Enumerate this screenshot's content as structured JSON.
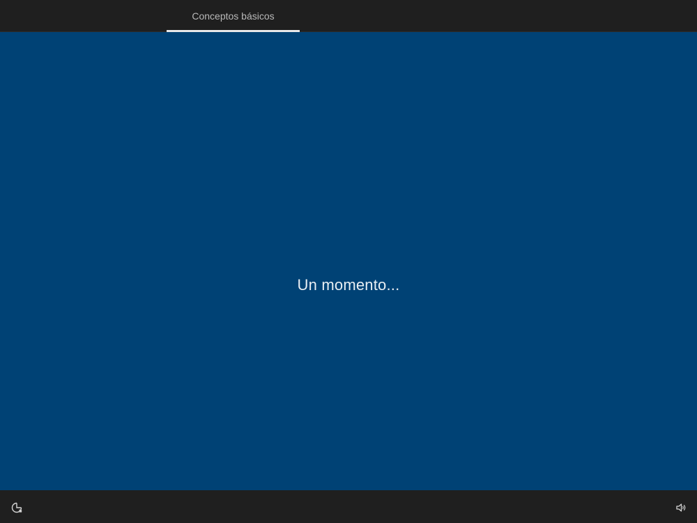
{
  "header": {
    "active_tab_label": "Conceptos básicos"
  },
  "main": {
    "status_text": "Un momento..."
  },
  "footer": {
    "left_icon": "accessibility-icon",
    "right_icon": "volume-icon"
  },
  "colors": {
    "background": "#004275",
    "bars": "#1f1f1f",
    "text": "#e9eef3",
    "tab_text": "#b9b9b9",
    "tab_underline": "#e8e8e8"
  }
}
